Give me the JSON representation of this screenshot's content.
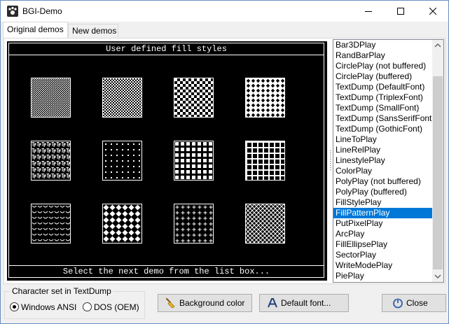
{
  "window": {
    "title": "BGI-Demo"
  },
  "tabs": [
    {
      "label": "Original demos",
      "active": true
    },
    {
      "label": "New demos",
      "active": false
    }
  ],
  "canvas": {
    "header": "User defined fill styles",
    "footer": "Select the next demo from the list box...",
    "patterns": [
      "hatch-fine",
      "checker-fine",
      "checker-medium",
      "diamond-grid",
      "text-tp",
      "dots-sparse",
      "blocks",
      "grid",
      "waves",
      "diamonds",
      "plus",
      "crosshatch"
    ]
  },
  "list": {
    "items": [
      "Bar3DPlay",
      "RandBarPlay",
      "CirclePlay (not buffered)",
      "CirclePlay (buffered)",
      "TextDump (DefaultFont)",
      "TextDump (TriplexFont)",
      "TextDump (SmallFont)",
      "TextDump (SansSerifFont)",
      "TextDump (GothicFont)",
      "LineToPlay",
      "LineRelPlay",
      "LinestylePlay",
      "ColorPlay",
      "PolyPlay (not buffered)",
      "PolyPlay (buffered)",
      "FillStylePlay",
      "FillPatternPlay",
      "PutPixelPlay",
      "ArcPlay",
      "FillEllipsePlay",
      "SectorPlay",
      "WriteModePlay",
      "PiePlay"
    ],
    "selected": "FillPatternPlay"
  },
  "charset": {
    "label": "Character set in TextDump",
    "options": [
      {
        "label": "Windows ANSI",
        "checked": true
      },
      {
        "label": "DOS (OEM)",
        "checked": false
      }
    ]
  },
  "buttons": {
    "background": "Background color",
    "font": "Default font...",
    "close": "Close"
  },
  "colors": {
    "selection": "#0078d7",
    "canvas": "#000000"
  }
}
